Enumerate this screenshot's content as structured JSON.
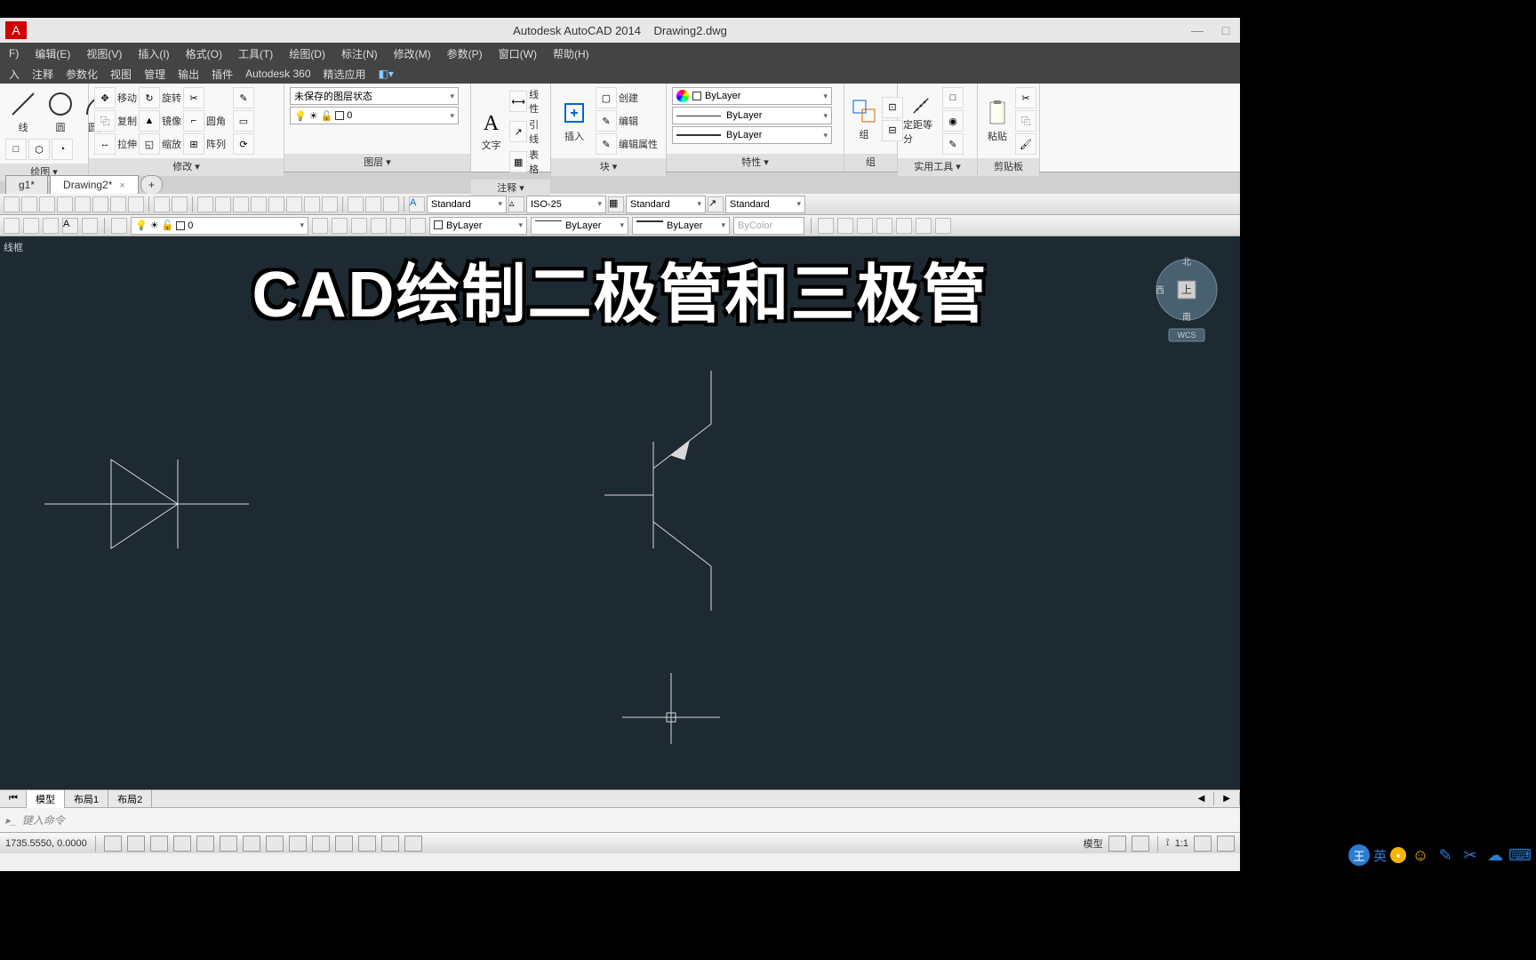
{
  "title": {
    "app": "Autodesk AutoCAD 2014",
    "doc": "Drawing2.dwg"
  },
  "menu": [
    "F)",
    "编辑(E)",
    "视图(V)",
    "插入(I)",
    "格式(O)",
    "工具(T)",
    "绘图(D)",
    "标注(N)",
    "修改(M)",
    "参数(P)",
    "窗口(W)",
    "帮助(H)"
  ],
  "ribbon_tabs": [
    "入",
    "注释",
    "参数化",
    "视图",
    "管理",
    "输出",
    "插件",
    "Autodesk 360",
    "精选应用"
  ],
  "panels": {
    "draw": {
      "title": "绘图 ▾",
      "line": "线",
      "circle": "圆",
      "arc": "圆弧"
    },
    "modify": {
      "title": "修改 ▾",
      "move": "移动",
      "rotate": "旋转",
      "copy": "复制",
      "mirror": "镜像",
      "stretch": "拉伸",
      "scale": "缩放",
      "fillet": "圆角",
      "array": "阵列"
    },
    "layer": {
      "title": "图层 ▾",
      "state_unsaved": "未保存的图层状态",
      "current": "0"
    },
    "annotate": {
      "title": "注释 ▾",
      "text": "文字",
      "linear": "线性",
      "leader": "引线",
      "table": "表格"
    },
    "block": {
      "title": "块 ▾",
      "insert": "插入",
      "create": "创建",
      "edit": "编辑",
      "edit_attr": "编辑属性"
    },
    "properties": {
      "title": "特性 ▾",
      "bylayer": "ByLayer"
    },
    "group": {
      "title": "组",
      "label": "组"
    },
    "utility": {
      "title": "实用工具 ▾",
      "measure": "定距等分"
    },
    "clipboard": {
      "title": "剪贴板",
      "paste": "粘贴"
    }
  },
  "doc_tabs": [
    {
      "label": "g1*",
      "active": false
    },
    {
      "label": "Drawing2*",
      "active": true
    }
  ],
  "toolbar_dropdowns": {
    "textstyle": "Standard",
    "dimstyle": "ISO-25",
    "tablestyle": "Standard",
    "mleaderstyle": "Standard"
  },
  "toolbar2": {
    "layer": "0",
    "color": "ByLayer",
    "linetype": "ByLayer",
    "lineweight": "ByLayer",
    "plotstyle": "ByColor"
  },
  "side_label": "线框",
  "overlay": "CAD绘制二极管和三极管",
  "viewcube": {
    "n": "北",
    "s": "南",
    "w": "西",
    "top": "上",
    "wcs": "WCS"
  },
  "layout_tabs": [
    "模型",
    "布局1",
    "布局2"
  ],
  "command_placeholder": "键入命令",
  "status": {
    "coords": "1735.5550, 0.0000",
    "scale": "1:1",
    "model": "模型"
  },
  "ime": {
    "label": "英"
  }
}
